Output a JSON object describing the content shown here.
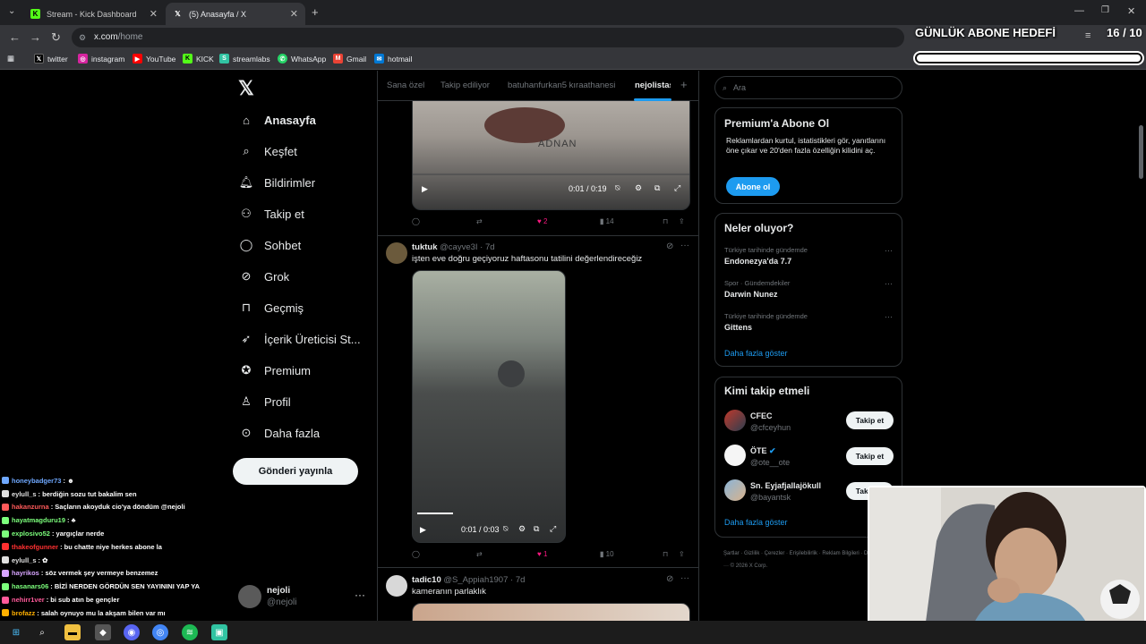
{
  "browser": {
    "tabs": [
      {
        "title": "Stream - Kick Dashboard",
        "favicon": "kick-icon"
      },
      {
        "title": "(5) Anasayfa / X",
        "favicon": "x-icon"
      }
    ],
    "url_host": "x.com",
    "url_path": "/home",
    "bookmarks": [
      "twitter",
      "instagram",
      "YouTube",
      "KICK",
      "streamlabs",
      "WhatsApp",
      "Gmail",
      "hotmail"
    ]
  },
  "overlay": {
    "goal_title": "GÜNLÜK ABONE HEDEFİ",
    "goal_count": "16 / 10",
    "goal_progress": 1.0
  },
  "x_nav": {
    "items": [
      {
        "label": "Anasayfa",
        "icon": "home-icon"
      },
      {
        "label": "Keşfet",
        "icon": "search-icon"
      },
      {
        "label": "Bildirimler",
        "icon": "bell-icon"
      },
      {
        "label": "Takip et",
        "icon": "add-user-icon"
      },
      {
        "label": "Sohbet",
        "icon": "chat-icon"
      },
      {
        "label": "Grok",
        "icon": "grok-icon"
      },
      {
        "label": "Geçmiş",
        "icon": "bookmark-icon"
      },
      {
        "label": "İçerik Üreticisi St...",
        "icon": "rocket-icon"
      },
      {
        "label": "Premium",
        "icon": "verified-icon"
      },
      {
        "label": "Profil",
        "icon": "person-icon"
      },
      {
        "label": "Daha fazla",
        "icon": "more-circle-icon"
      }
    ],
    "post_button": "Gönderi yayınla",
    "profile_name": "nejoli",
    "profile_handle": "@nejoli"
  },
  "timeline": {
    "tabs": [
      "Sana özel",
      "Takip ediliyor",
      "batuhanfurkan5 kıraathanesi",
      "nejolistas"
    ],
    "tweet0": {
      "video_caption": "ADNAN",
      "time": "0:01 / 0:19",
      "likes": "2",
      "views": "14"
    },
    "tweet1": {
      "name": "tuktuk",
      "handle": "@cayve3I",
      "age": "· 7d",
      "text": "işten eve doğru geçiyoruz haftasonu tatilini değerlendireceğiz",
      "time": "0:01 / 0:03",
      "likes": "1",
      "views": "10"
    },
    "tweet2": {
      "name": "tadic10",
      "handle": "@S_Appiah1907",
      "age": "· 7d",
      "text": "kameranın parlaklık"
    }
  },
  "sidebar": {
    "search_placeholder": "Ara",
    "premium": {
      "title": "Premium'a Abone Ol",
      "body": "Reklamlardan kurtul, istatistikleri gör, yanıtlarını öne çıkar ve 20'den fazla özelliğin kilidini aç.",
      "button": "Abone ol"
    },
    "trends": {
      "title": "Neler oluyor?",
      "items": [
        {
          "meta": "Türkiye tarihinde gündemde",
          "name": "Endonezya'da 7.7"
        },
        {
          "meta": "Spor · Gündemdekiler",
          "name": "Darwin Nunez"
        },
        {
          "meta": "Türkiye tarihinde gündemde",
          "name": "Gittens"
        }
      ],
      "more": "Daha fazla göster"
    },
    "who_to_follow": {
      "title": "Kimi takip etmeli",
      "items": [
        {
          "name": "CFEC",
          "handle": "@cfceyhun",
          "button": "Takip et"
        },
        {
          "name": "ÖTE",
          "handle": "@ote__ote",
          "button": "Takip et"
        },
        {
          "name": "Sn. Eyjafjallajökull",
          "handle": "@bayantsk",
          "button": "Takip et"
        }
      ],
      "more": "Daha fazla göster"
    },
    "footer": "Şartlar · Gizlilik · Çerezler · Erişilebilirlik · Reklam Bilgileri · Daha fazla ··· © 2026 X Corp."
  },
  "chat": [
    {
      "user": "honeybadger73",
      "msg": ": ☻",
      "color": "#6fa8ff"
    },
    {
      "user": "eylull_s",
      "msg": ": berdiğin sozu tut bakalim sen",
      "color": "#e0e0e0"
    },
    {
      "user": "hakanzurna",
      "msg": ": Saçların akoyduk cio'ya döndüm @nejoli",
      "color": "#ff5a5a"
    },
    {
      "user": "hayatmagduru19",
      "msg": ": ♣",
      "color": "#7cff7c"
    },
    {
      "user": "explosivo52",
      "msg": ": yargıçlar nerde",
      "color": "#7cff7c"
    },
    {
      "user": "thakeofgunner",
      "msg": ": bu chatte niye herkes abone la",
      "color": "#ff3030"
    },
    {
      "user": "eylull_s",
      "msg": ": ✿",
      "color": "#e0e0e0"
    },
    {
      "user": "hayrikos",
      "msg": ": söz vermek şey vermeye benzemez",
      "color": "#d7a4ff"
    },
    {
      "user": "hasanars06",
      "msg": ": BİZİ NERDEN GÖRDÜN SEN YAYININI YAP YA",
      "color": "#7cff7c"
    },
    {
      "user": "nehirr1ver",
      "msg": ": bi sub atın be gençler",
      "color": "#ff5a9a"
    },
    {
      "user": "brofazz",
      "msg": ": salah oynuyo mu la akşam bilen var mı",
      "color": "#ffb000"
    },
    {
      "user": "tuktukpilotu",
      "msg": ": ☺",
      "color": "#4fc3ff"
    }
  ],
  "colors": {
    "accent": "#1d9bf0",
    "like": "#f91880",
    "kick": "#53fc18"
  }
}
